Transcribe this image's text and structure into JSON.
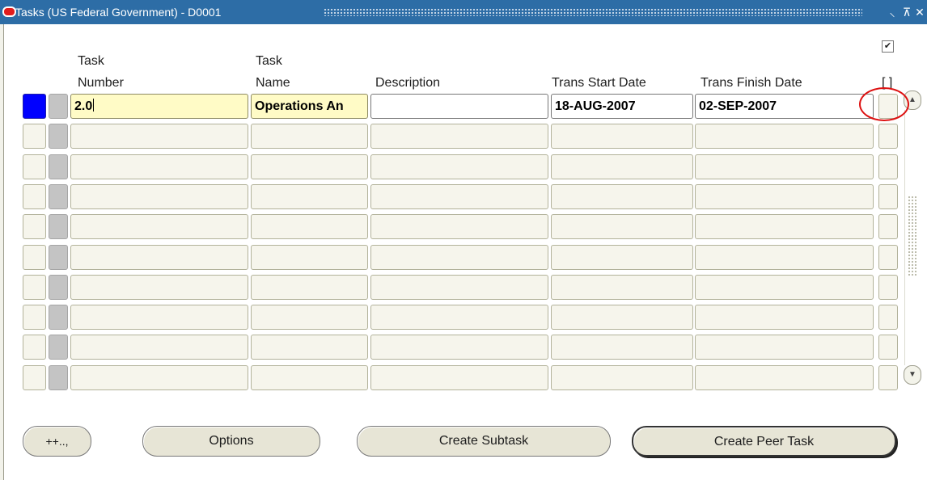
{
  "window": {
    "title": "Tasks (US Federal Government) - D0001",
    "controls": {
      "minimize": "⸜",
      "maximize": "⊼",
      "close": "✕"
    }
  },
  "columns": {
    "task_number": [
      "Task",
      "Number"
    ],
    "task_name": [
      "Task",
      "Name"
    ],
    "description": "Description",
    "trans_start_date": "Trans Start Date",
    "trans_finish_date": "Trans Finish Date",
    "flag": "[ ]"
  },
  "header_checkbox": {
    "checked": true,
    "glyph": "✔"
  },
  "rows": [
    {
      "task_number": "2.0",
      "task_name": "Operations An",
      "description": "",
      "trans_start_date": "18-AUG-2007",
      "trans_finish_date": "02-SEP-2007"
    },
    {
      "task_number": "",
      "task_name": "",
      "description": "",
      "trans_start_date": "",
      "trans_finish_date": ""
    },
    {
      "task_number": "",
      "task_name": "",
      "description": "",
      "trans_start_date": "",
      "trans_finish_date": ""
    },
    {
      "task_number": "",
      "task_name": "",
      "description": "",
      "trans_start_date": "",
      "trans_finish_date": ""
    },
    {
      "task_number": "",
      "task_name": "",
      "description": "",
      "trans_start_date": "",
      "trans_finish_date": ""
    },
    {
      "task_number": "",
      "task_name": "",
      "description": "",
      "trans_start_date": "",
      "trans_finish_date": ""
    },
    {
      "task_number": "",
      "task_name": "",
      "description": "",
      "trans_start_date": "",
      "trans_finish_date": ""
    },
    {
      "task_number": "",
      "task_name": "",
      "description": "",
      "trans_start_date": "",
      "trans_finish_date": ""
    },
    {
      "task_number": "",
      "task_name": "",
      "description": "",
      "trans_start_date": "",
      "trans_finish_date": ""
    },
    {
      "task_number": "",
      "task_name": "",
      "description": "",
      "trans_start_date": "",
      "trans_finish_date": ""
    }
  ],
  "scrollbar": {
    "up_glyph": "▲",
    "down_glyph": "▼"
  },
  "buttons": {
    "more": "++..,",
    "options": "Options",
    "create_subtask": "Create Subtask",
    "create_peer_task": "Create Peer Task"
  },
  "colors": {
    "title_bar": "#2d6da6",
    "current_record_indicator": "#0000ff",
    "required_field": "#fffbc6",
    "highlight_annotation": "#dd1111"
  },
  "icons": {
    "app_logo": "oracle-logo-icon"
  }
}
